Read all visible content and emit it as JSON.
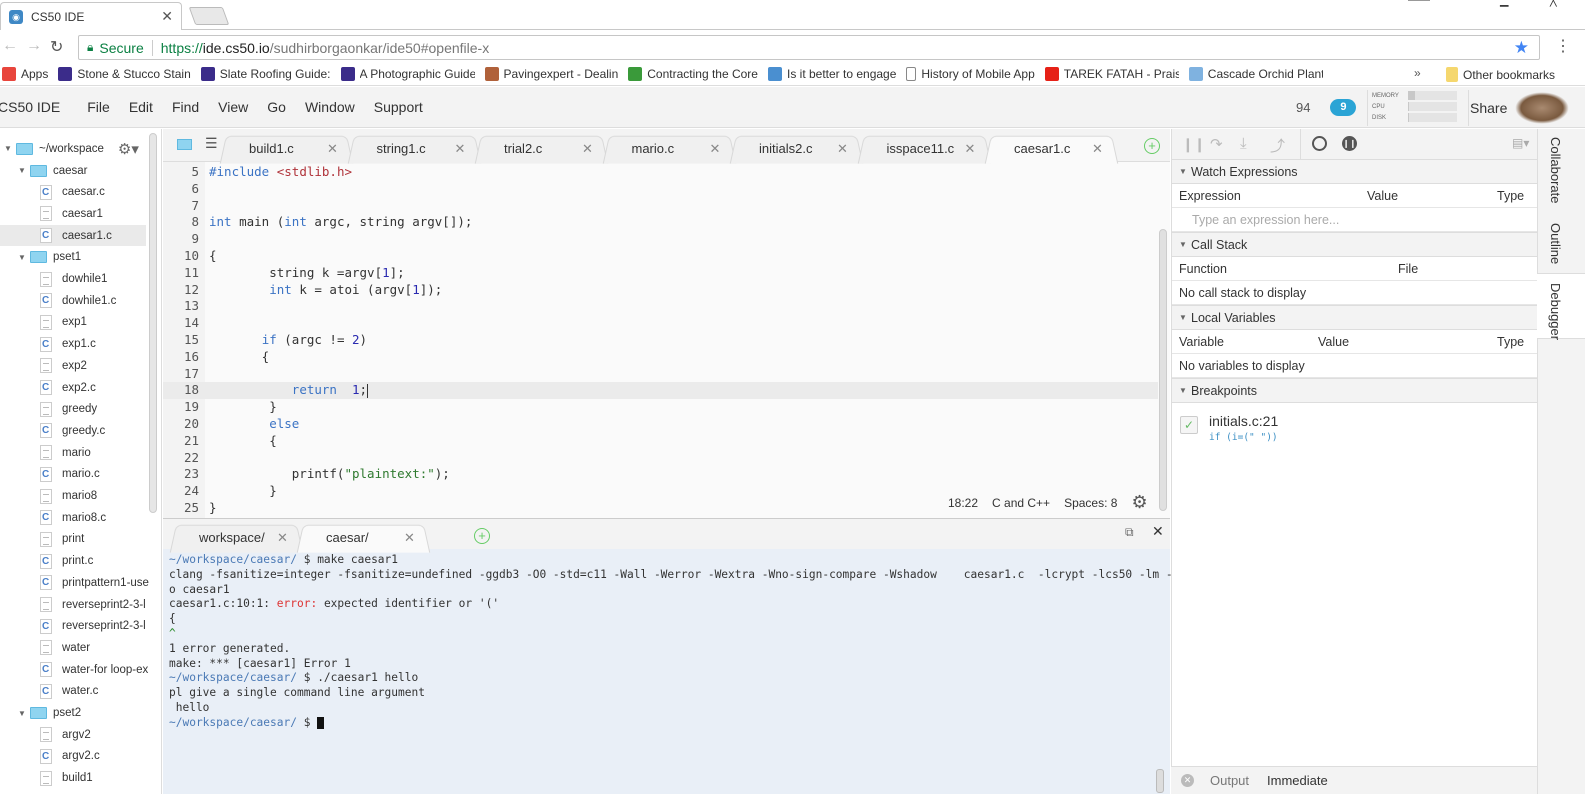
{
  "browser": {
    "tab_title": "CS50 IDE",
    "url_secure_label": "Secure",
    "url_scheme": "https://",
    "url_host": "ide.cs50.io",
    "url_path": "/sudhirborgaonkar/ide50#openfile-x",
    "bookmarks": [
      {
        "label": "Apps",
        "color": "#e8453c"
      },
      {
        "label": "Stone & Stucco Stain",
        "color": "#3b2c8a"
      },
      {
        "label": "Slate Roofing Guide:",
        "color": "#3b2c8a"
      },
      {
        "label": "A Photographic Guide",
        "color": "#3b2c8a"
      },
      {
        "label": "Pavingexpert - Dealin",
        "color": "#b0613a"
      },
      {
        "label": "Contracting the Core",
        "color": "#3a9a3a"
      },
      {
        "label": "Is it better to engage",
        "color": "#4a8fd0"
      },
      {
        "label": "History of Mobile App",
        "color": "#ffffff"
      },
      {
        "label": "TAREK FATAH - Praisin",
        "color": "#e62117"
      },
      {
        "label": "Cascade Orchid Plant",
        "color": "#7fb2e0"
      }
    ],
    "more_bookmarks": "»",
    "other_bookmarks": "Other bookmarks"
  },
  "ide": {
    "menu": [
      "CS50 IDE",
      "File",
      "Edit",
      "Find",
      "View",
      "Go",
      "Window",
      "Support"
    ],
    "count": "94",
    "cloud_badge": "9",
    "meters": [
      {
        "label": "MEMORY",
        "value": 0.15
      },
      {
        "label": "CPU",
        "value": 0.02
      },
      {
        "label": "DISK",
        "value": 0.03
      }
    ],
    "share_label": "Share"
  },
  "tree": {
    "root": "~/workspace",
    "items": [
      {
        "label": "caesar",
        "type": "folder",
        "level": 1
      },
      {
        "label": "caesar.c",
        "type": "c",
        "level": 2
      },
      {
        "label": "caesar1",
        "type": "txt",
        "level": 2
      },
      {
        "label": "caesar1.c",
        "type": "c",
        "level": 2,
        "selected": true
      },
      {
        "label": "pset1",
        "type": "folder",
        "level": 1
      },
      {
        "label": "dowhile1",
        "type": "txt",
        "level": 2
      },
      {
        "label": "dowhile1.c",
        "type": "c",
        "level": 2
      },
      {
        "label": "exp1",
        "type": "txt",
        "level": 2
      },
      {
        "label": "exp1.c",
        "type": "c",
        "level": 2
      },
      {
        "label": "exp2",
        "type": "txt",
        "level": 2
      },
      {
        "label": "exp2.c",
        "type": "c",
        "level": 2
      },
      {
        "label": "greedy",
        "type": "txt",
        "level": 2
      },
      {
        "label": "greedy.c",
        "type": "c",
        "level": 2
      },
      {
        "label": "mario",
        "type": "txt",
        "level": 2
      },
      {
        "label": "mario.c",
        "type": "c",
        "level": 2
      },
      {
        "label": "mario8",
        "type": "txt",
        "level": 2
      },
      {
        "label": "mario8.c",
        "type": "c",
        "level": 2
      },
      {
        "label": "print",
        "type": "txt",
        "level": 2
      },
      {
        "label": "print.c",
        "type": "c",
        "level": 2
      },
      {
        "label": "printpattern1-use",
        "type": "c",
        "level": 2
      },
      {
        "label": "reverseprint2-3-l",
        "type": "txt",
        "level": 2
      },
      {
        "label": "reverseprint2-3-l",
        "type": "c",
        "level": 2
      },
      {
        "label": "water",
        "type": "txt",
        "level": 2
      },
      {
        "label": "water-for loop-ex",
        "type": "c",
        "level": 2
      },
      {
        "label": "water.c",
        "type": "c",
        "level": 2
      },
      {
        "label": "pset2",
        "type": "folder",
        "level": 1
      },
      {
        "label": "argv2",
        "type": "txt",
        "level": 2
      },
      {
        "label": "argv2.c",
        "type": "c",
        "level": 2
      },
      {
        "label": "build1",
        "type": "txt",
        "level": 2
      }
    ]
  },
  "editor": {
    "tabs": [
      {
        "label": "build1.c"
      },
      {
        "label": "string1.c"
      },
      {
        "label": "trial2.c"
      },
      {
        "label": "mario.c"
      },
      {
        "label": "initials2.c"
      },
      {
        "label": "isspace11.c"
      },
      {
        "label": "caesar1.c",
        "active": true
      }
    ],
    "lines": [
      {
        "n": "5",
        "html": "<span class='pp'>#include</span> <span class='inc'>&lt;stdlib.h&gt;</span>"
      },
      {
        "n": "6",
        "html": ""
      },
      {
        "n": "7",
        "html": ""
      },
      {
        "n": "8",
        "html": "<span class='kw'>int</span> main (<span class='kw'>int</span> argc, string argv[]);"
      },
      {
        "n": "9",
        "html": ""
      },
      {
        "n": "10",
        "html": "{"
      },
      {
        "n": "11",
        "html": "        string k =argv[<span class='num'>1</span>];"
      },
      {
        "n": "12",
        "html": "        <span class='kw'>int</span> k = atoi (argv[<span class='num'>1</span>]);"
      },
      {
        "n": "13",
        "html": ""
      },
      {
        "n": "14",
        "html": ""
      },
      {
        "n": "15",
        "html": "       <span class='kw'>if</span> (argc != <span class='num'>2</span>)"
      },
      {
        "n": "16",
        "html": "       {"
      },
      {
        "n": "17",
        "html": ""
      },
      {
        "n": "18",
        "html": "           <span class='kw'>return</span>  <span class='num'>1</span>;",
        "highlight": true
      },
      {
        "n": "19",
        "html": "        }"
      },
      {
        "n": "20",
        "html": "        <span class='kw'>else</span>"
      },
      {
        "n": "21",
        "html": "        {"
      },
      {
        "n": "22",
        "html": ""
      },
      {
        "n": "23",
        "html": "           printf(<span class='str'>\"plaintext:\"</span>);"
      },
      {
        "n": "24",
        "html": "        }"
      },
      {
        "n": "25",
        "html": "}"
      }
    ],
    "status": {
      "position": "18:22",
      "language": "C and C++",
      "spaces": "Spaces: 8"
    }
  },
  "terminal": {
    "tabs": [
      {
        "label": "workspace/"
      },
      {
        "label": "caesar/",
        "active": true
      }
    ],
    "lines": [
      {
        "prompt": "~/workspace/caesar/",
        "text": " $ make caesar1"
      },
      {
        "text": "clang -fsanitize=integer -fsanitize=undefined -ggdb3 -O0 -std=c11 -Wall -Werror -Wextra -Wno-sign-compare -Wshadow    caesar1.c  -lcrypt -lcs50 -lm -"
      },
      {
        "text": "o caesar1"
      },
      {
        "pre": "caesar1.c:10:1: ",
        "error": "error:",
        "text": " expected identifier or '('"
      },
      {
        "text": "{"
      },
      {
        "caret": "^"
      },
      {
        "text": "1 error generated."
      },
      {
        "text": "make: *** [caesar1] Error 1"
      },
      {
        "prompt": "~/workspace/caesar/",
        "text": " $ ./caesar1 hello"
      },
      {
        "text": "pl give a single command line argument"
      },
      {
        "text": " hello"
      },
      {
        "prompt": "~/workspace/caesar/",
        "text": " $ ",
        "cursor": true
      }
    ]
  },
  "debugger": {
    "watch": {
      "title": "Watch Expressions",
      "cols": [
        "Expression",
        "Value",
        "Type"
      ],
      "placeholder": "Type an expression here..."
    },
    "callstack": {
      "title": "Call Stack",
      "cols": [
        "Function",
        "File"
      ],
      "empty": "No call stack to display"
    },
    "locals": {
      "title": "Local Variables",
      "cols": [
        "Variable",
        "Value",
        "Type"
      ],
      "empty": "No variables to display"
    },
    "breakpoints": {
      "title": "Breakpoints",
      "items": [
        {
          "file": "initials.c:21",
          "code": "if (i=(\" \"))",
          "enabled": true
        }
      ]
    },
    "bottom_tabs": [
      "Output",
      "Immediate"
    ]
  },
  "right_tabs": [
    "Collaborate",
    "Outline",
    "Debugger"
  ]
}
